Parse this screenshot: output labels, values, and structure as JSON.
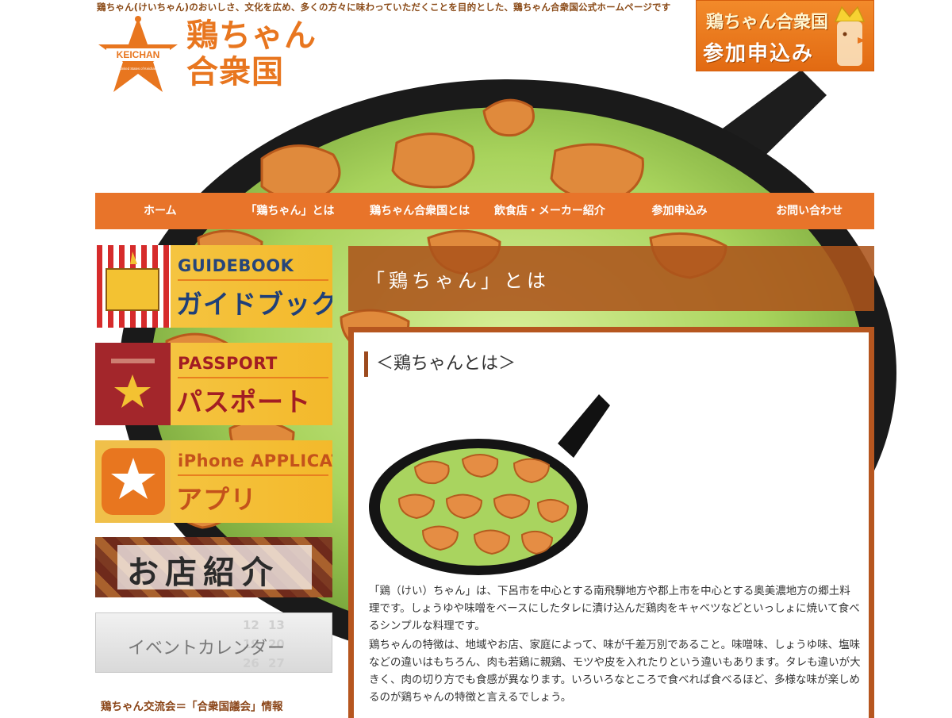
{
  "header": {
    "tagline": "鶏ちゃん(けいちゃん)のおいしさ、文化を広め、多くの方々に味わっていただくことを目的とした、鶏ちゃん合衆国公式ホームページです",
    "logo": {
      "badge_text": "KEICHAN",
      "badge_subtext": "United States of Keichan",
      "title_line1": "鶏ちゃん",
      "title_line2": "合衆国"
    },
    "join_banner": {
      "line1": "鶏ちゃん合衆国",
      "line2": "参加申込み"
    }
  },
  "nav": {
    "items": [
      {
        "label": "ホーム"
      },
      {
        "label": "「鶏ちゃん」とは"
      },
      {
        "label": "鶏ちゃん合衆国とは"
      },
      {
        "label": "飲食店・メーカー紹介"
      },
      {
        "label": "参加申込み"
      },
      {
        "label": "お問い合わせ"
      }
    ]
  },
  "sidebar": {
    "guidebook": {
      "en": "GUIDEBOOK",
      "jp": "ガイドブック"
    },
    "passport": {
      "en": "PASSPORT",
      "jp": "パスポート"
    },
    "app": {
      "en": "iPhone APPLICATION",
      "jp": "アプリ"
    },
    "shop": {
      "label": "お店紹介"
    },
    "event": {
      "label": "イベントカレンダー"
    },
    "council_link": "鶏ちゃん交流会＝「合衆国議会」情報"
  },
  "main": {
    "page_title": "「鶏ちゃん」とは",
    "section_title": "＜鶏ちゃんとは＞",
    "paragraph1": "「鶏（けい）ちゃん」は、下呂市を中心とする南飛騨地方や郡上市を中心とする奥美濃地方の郷土料理です。しょうゆや味噌をベースにしたタレに漬け込んだ鶏肉をキャベツなどといっしょに焼いて食べるシンプルな料理です。",
    "paragraph2": "鶏ちゃんの特徴は、地域やお店、家庭によって、味が千差万別であること。味噌味、しょうゆ味、塩味などの違いはもちろん、肉も若鶏に親鶏、モツや皮を入れたりという違いもあります。タレも違いが大きく、肉の切り方でも食感が異なります。いろいろなところで食べれば食べるほど、多様な味が楽しめるのが鶏ちゃんの特徴と言えるでしょう。"
  },
  "colors": {
    "accent_orange": "#e8742a",
    "heading_brown": "#ac541b",
    "link_brown": "#8a4417"
  }
}
